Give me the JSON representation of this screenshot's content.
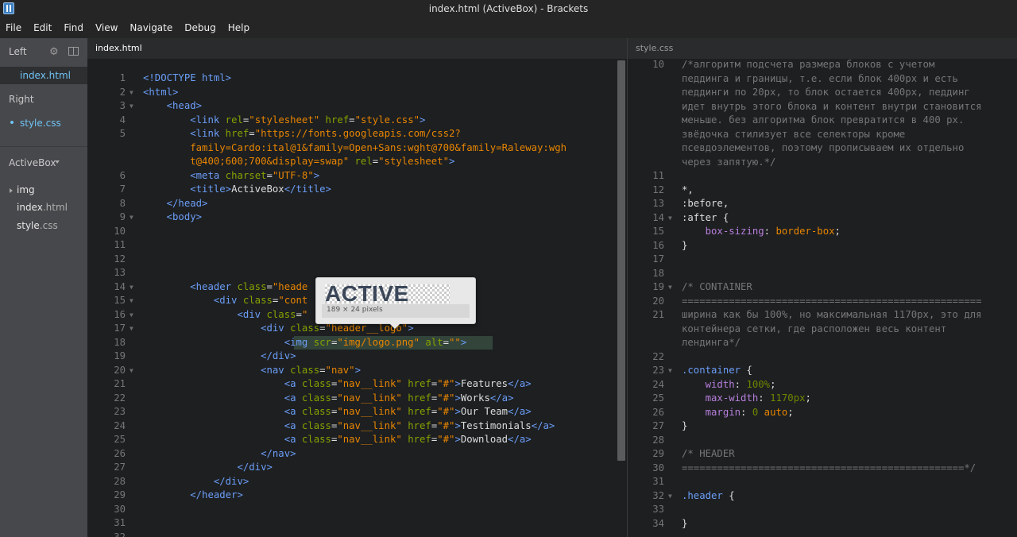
{
  "window": {
    "title": "index.html (ActiveBox) - Brackets",
    "app_icon": "brackets-icon"
  },
  "menu": [
    "File",
    "Edit",
    "Find",
    "View",
    "Navigate",
    "Debug",
    "Help"
  ],
  "sidebar": {
    "left_pane": {
      "label": "Left",
      "file": "index.html"
    },
    "right_pane": {
      "label": "Right",
      "file": "style.css"
    },
    "project": {
      "name": "ActiveBox",
      "tree": [
        {
          "name": "img",
          "ext": ""
        },
        {
          "name": "index",
          "ext": ".html"
        },
        {
          "name": "style",
          "ext": ".css"
        }
      ]
    }
  },
  "left_editor": {
    "tab": "index.html",
    "lines": [
      {
        "n": "1",
        "fold": "",
        "html": "<span class='t'>&lt;!DOCTYPE html&gt;</span>"
      },
      {
        "n": "2",
        "fold": "▼",
        "html": "<span class='t'>&lt;html&gt;</span>"
      },
      {
        "n": "3",
        "fold": "▼",
        "html": "    <span class='t'>&lt;head&gt;</span>"
      },
      {
        "n": "4",
        "fold": "",
        "html": "        <span class='t'>&lt;link</span> <span class='a'>rel</span>=<span class='s'>\"stylesheet\"</span> <span class='a'>href</span>=<span class='s'>\"style.css\"</span><span class='t'>&gt;</span>"
      },
      {
        "n": "5",
        "fold": "",
        "html": "        <span class='t'>&lt;link</span> <span class='a'>href</span>=<span class='s'>\"https://fonts.googleapis.com/css2?</span>"
      },
      {
        "n": "",
        "fold": "",
        "html": "        <span class='s'>family=Cardo:ital@1&amp;family=Open+Sans:wght@700&amp;family=Raleway:wgh</span>"
      },
      {
        "n": "",
        "fold": "",
        "html": "        <span class='s'>t@400;600;700&amp;display=swap\"</span> <span class='a'>rel</span>=<span class='s'>\"stylesheet\"</span><span class='t'>&gt;</span>"
      },
      {
        "n": "6",
        "fold": "",
        "html": "        <span class='t'>&lt;meta</span> <span class='a'>charset</span>=<span class='s'>\"UTF-8\"</span><span class='t'>&gt;</span>"
      },
      {
        "n": "7",
        "fold": "",
        "html": "        <span class='t'>&lt;title&gt;</span><span class='x'>ActiveBox</span><span class='t'>&lt;/title&gt;</span>"
      },
      {
        "n": "8",
        "fold": "",
        "html": "    <span class='t'>&lt;/head&gt;</span>"
      },
      {
        "n": "9",
        "fold": "▼",
        "html": "    <span class='t'>&lt;body&gt;</span>"
      },
      {
        "n": "10",
        "fold": "",
        "html": ""
      },
      {
        "n": "11",
        "fold": "",
        "html": ""
      },
      {
        "n": "12",
        "fold": "",
        "html": ""
      },
      {
        "n": "13",
        "fold": "",
        "html": ""
      },
      {
        "n": "14",
        "fold": "▼",
        "html": "        <span class='t'>&lt;header</span> <span class='a'>class</span>=<span class='s'>\"heade</span>"
      },
      {
        "n": "15",
        "fold": "▼",
        "html": "            <span class='t'>&lt;div</span> <span class='a'>class</span>=<span class='s'>\"cont</span>"
      },
      {
        "n": "16",
        "fold": "▼",
        "html": "                <span class='t'>&lt;div</span> <span class='a'>class</span>=<span class='s'>\"</span>"
      },
      {
        "n": "17",
        "fold": "▼",
        "html": "                    <span class='t'>&lt;div</span> <span class='a'>class</span>=<span class='s'>\"header__logo\"</span><span class='t'>&gt;</span>"
      },
      {
        "n": "18",
        "fold": "",
        "html": "                        <span class='t'>&lt;img</span> <span class='a'>scr</span>=<span class='s'>\"img/logo.png\"</span> <span class='a'>alt</span>=<span class='s'>\"\"</span><span class='t'>&gt;</span>"
      },
      {
        "n": "19",
        "fold": "",
        "html": "                    <span class='t'>&lt;/div&gt;</span>"
      },
      {
        "n": "20",
        "fold": "▼",
        "html": "                    <span class='t'>&lt;nav</span> <span class='a'>class</span>=<span class='s'>\"nav\"</span><span class='t'>&gt;</span>"
      },
      {
        "n": "21",
        "fold": "",
        "html": "                        <span class='t'>&lt;a</span> <span class='a'>class</span>=<span class='s'>\"nav__link\"</span> <span class='a'>href</span>=<span class='s'>\"#\"</span><span class='t'>&gt;</span><span class='x'>Features</span><span class='t'>&lt;/a&gt;</span>"
      },
      {
        "n": "22",
        "fold": "",
        "html": "                        <span class='t'>&lt;a</span> <span class='a'>class</span>=<span class='s'>\"nav__link\"</span> <span class='a'>href</span>=<span class='s'>\"#\"</span><span class='t'>&gt;</span><span class='x'>Works</span><span class='t'>&lt;/a&gt;</span>"
      },
      {
        "n": "23",
        "fold": "",
        "html": "                        <span class='t'>&lt;a</span> <span class='a'>class</span>=<span class='s'>\"nav__link\"</span> <span class='a'>href</span>=<span class='s'>\"#\"</span><span class='t'>&gt;</span><span class='x'>Our Team</span><span class='t'>&lt;/a&gt;</span>"
      },
      {
        "n": "24",
        "fold": "",
        "html": "                        <span class='t'>&lt;a</span> <span class='a'>class</span>=<span class='s'>\"nav__link\"</span> <span class='a'>href</span>=<span class='s'>\"#\"</span><span class='t'>&gt;</span><span class='x'>Testimonials</span><span class='t'>&lt;/a&gt;</span>"
      },
      {
        "n": "25",
        "fold": "",
        "html": "                        <span class='t'>&lt;a</span> <span class='a'>class</span>=<span class='s'>\"nav__link\"</span> <span class='a'>href</span>=<span class='s'>\"#\"</span><span class='t'>&gt;</span><span class='x'>Download</span><span class='t'>&lt;/a&gt;</span>"
      },
      {
        "n": "26",
        "fold": "",
        "html": "                    <span class='t'>&lt;/nav&gt;</span>"
      },
      {
        "n": "27",
        "fold": "",
        "html": "                <span class='t'>&lt;/div&gt;</span>"
      },
      {
        "n": "28",
        "fold": "",
        "html": "            <span class='t'>&lt;/div&gt;</span>"
      },
      {
        "n": "29",
        "fold": "",
        "html": "        <span class='t'>&lt;/header&gt;</span>"
      },
      {
        "n": "30",
        "fold": "",
        "html": ""
      },
      {
        "n": "31",
        "fold": "",
        "html": ""
      },
      {
        "n": "32",
        "fold": "",
        "html": ""
      }
    ],
    "highlight_line": "18"
  },
  "image_preview": {
    "logo_text": "ACTIVE",
    "size_text": "189 × 24 pixels"
  },
  "right_editor": {
    "tab": "style.css",
    "lines": [
      {
        "n": "10",
        "fold": "",
        "html": "<span class='c'>/*алгоритм подсчета размера блоков с учетом</span>"
      },
      {
        "n": "",
        "fold": "",
        "html": "<span class='c'>педдинга и границы, т.е. если блок 400px и есть</span>"
      },
      {
        "n": "",
        "fold": "",
        "html": "<span class='c'>педдинги по 20px, то блок остается 400px, педдинг</span>"
      },
      {
        "n": "",
        "fold": "",
        "html": "<span class='c'>идет внутрь этого блока и контент внутри становится</span>"
      },
      {
        "n": "",
        "fold": "",
        "html": "<span class='c'>меньше. без алгоритма блок превратится в 400 px.</span>"
      },
      {
        "n": "",
        "fold": "",
        "html": "<span class='c'>звёдочка стилизует все селекторы кроме</span>"
      },
      {
        "n": "",
        "fold": "",
        "html": "<span class='c'>псевдоэлементов, поэтому прописываем их отдельно</span>"
      },
      {
        "n": "",
        "fold": "",
        "html": "<span class='c'>через запятую.*/</span>"
      },
      {
        "n": "11",
        "fold": "",
        "html": ""
      },
      {
        "n": "12",
        "fold": "",
        "html": "<span class='sel'>*,</span>"
      },
      {
        "n": "13",
        "fold": "",
        "html": "<span class='sel'>:before,</span>"
      },
      {
        "n": "14",
        "fold": "▼",
        "html": "<span class='sel'>:after {</span>"
      },
      {
        "n": "15",
        "fold": "",
        "html": "    <span class='prop'>box-sizing</span>: <span class='val'>border-box</span>;"
      },
      {
        "n": "16",
        "fold": "",
        "html": "}"
      },
      {
        "n": "17",
        "fold": "",
        "html": ""
      },
      {
        "n": "18",
        "fold": "",
        "html": ""
      },
      {
        "n": "19",
        "fold": "▼",
        "html": "<span class='c'>/* CONTAINER</span>"
      },
      {
        "n": "20",
        "fold": "",
        "html": "<span class='c'>===================================================</span>"
      },
      {
        "n": "21",
        "fold": "",
        "html": "<span class='c'>ширина как бы 100%, но максимальная 1170px, это для</span>"
      },
      {
        "n": "",
        "fold": "",
        "html": "<span class='c'>контейнера сетки, где расположен весь контент</span>"
      },
      {
        "n": "",
        "fold": "",
        "html": "<span class='c'>лендинга*/</span>"
      },
      {
        "n": "22",
        "fold": "",
        "html": ""
      },
      {
        "n": "23",
        "fold": "▼",
        "html": "<span class='cls'>.container</span> {"
      },
      {
        "n": "24",
        "fold": "",
        "html": "    <span class='prop'>width</span>: <span class='num'>100%</span>;"
      },
      {
        "n": "25",
        "fold": "",
        "html": "    <span class='prop'>max-width</span>: <span class='num'>1170px</span>;"
      },
      {
        "n": "26",
        "fold": "",
        "html": "    <span class='prop'>margin</span>: <span class='num'>0</span> <span class='val'>auto</span>;"
      },
      {
        "n": "27",
        "fold": "",
        "html": "}"
      },
      {
        "n": "28",
        "fold": "",
        "html": ""
      },
      {
        "n": "29",
        "fold": "",
        "html": "<span class='c'>/* HEADER</span>"
      },
      {
        "n": "30",
        "fold": "",
        "html": "<span class='c'>================================================*/</span>"
      },
      {
        "n": "31",
        "fold": "",
        "html": ""
      },
      {
        "n": "32",
        "fold": "▼",
        "html": "<span class='cls'>.header</span> {"
      },
      {
        "n": "33",
        "fold": "",
        "html": ""
      },
      {
        "n": "34",
        "fold": "",
        "html": "}"
      }
    ]
  }
}
